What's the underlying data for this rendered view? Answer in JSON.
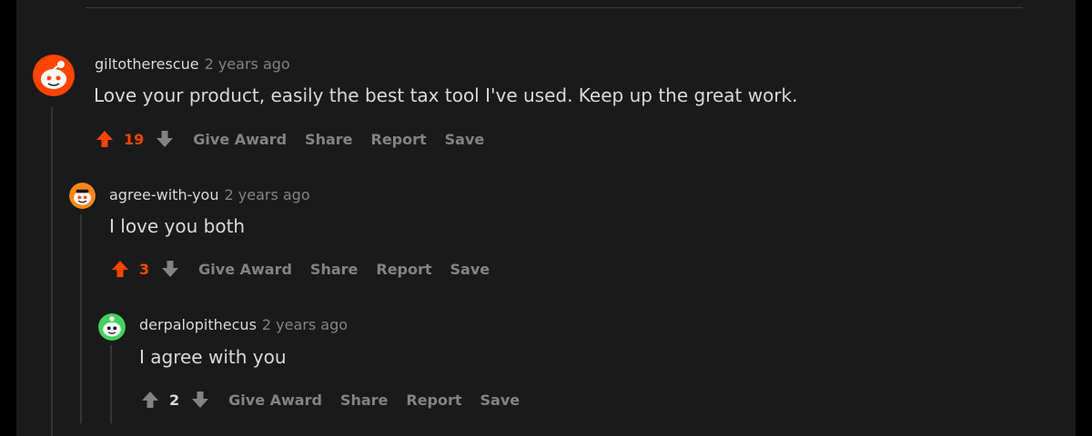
{
  "colors": {
    "background": "#1a1a1b",
    "upvote_active": "#ff4500",
    "muted": "#818384",
    "text": "#d7dadc"
  },
  "comments": [
    {
      "username": "giltotherescue",
      "time": "2 years ago",
      "body": "Love your product, easily the best tax tool I've used. Keep up the great work.",
      "score": "19",
      "upvoted": true,
      "avatar_color": "#ff4500",
      "actions": [
        "Give Award",
        "Share",
        "Report",
        "Save"
      ]
    },
    {
      "username": "agree-with-you",
      "time": "2 years ago",
      "body": "I love you both",
      "score": "3",
      "upvoted": true,
      "avatar_color": "#ff8717",
      "actions": [
        "Give Award",
        "Share",
        "Report",
        "Save"
      ]
    },
    {
      "username": "derpalopithecus",
      "time": "2 years ago",
      "body": "I agree with you",
      "score": "2",
      "upvoted": false,
      "avatar_color": "#46d160",
      "actions": [
        "Give Award",
        "Share",
        "Report",
        "Save"
      ]
    }
  ]
}
